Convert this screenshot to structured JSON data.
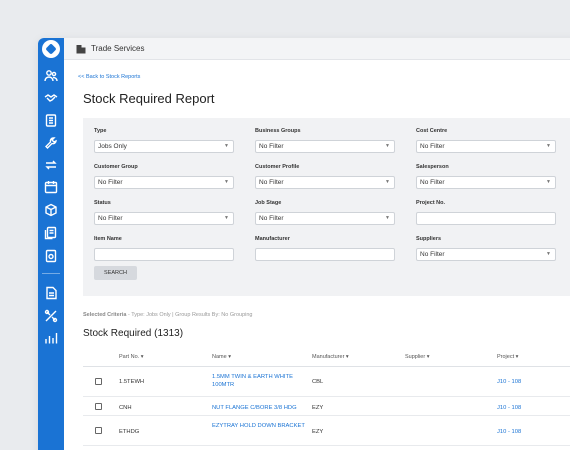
{
  "app": {
    "title": "Trade Services"
  },
  "page": {
    "back_link": "<< Back to Stock Reports",
    "title": "Stock Required Report"
  },
  "filters": [
    {
      "label": "Type",
      "value": "Jobs Only",
      "kind": "select"
    },
    {
      "label": "Business Groups",
      "value": "No Filter",
      "kind": "select"
    },
    {
      "label": "Cost Centre",
      "value": "No Filter",
      "kind": "select"
    },
    {
      "label": "Customer Group",
      "value": "No Filter",
      "kind": "select"
    },
    {
      "label": "Customer Profile",
      "value": "No Filter",
      "kind": "select"
    },
    {
      "label": "Salesperson",
      "value": "No Filter",
      "kind": "select"
    },
    {
      "label": "Status",
      "value": "No Filter",
      "kind": "select"
    },
    {
      "label": "Job Stage",
      "value": "No Filter",
      "kind": "select"
    },
    {
      "label": "Project No.",
      "value": "",
      "kind": "text"
    },
    {
      "label": "Item Name",
      "value": "",
      "kind": "text"
    },
    {
      "label": "Manufacturer",
      "value": "",
      "kind": "text"
    },
    {
      "label": "Suppliers",
      "value": "No Filter",
      "kind": "select"
    }
  ],
  "search_button": "SEARCH",
  "criteria": {
    "label": "Selected Criteria",
    "text": " - Type: Jobs Only | Group Results By: No Grouping"
  },
  "results": {
    "heading": "Stock Required (1313)",
    "columns": [
      "Part No. ▾",
      "Name ▾",
      "Manufacturer ▾",
      "Supplier ▾",
      "Project ▾"
    ],
    "rows": [
      {
        "part_no": "1.5TEWH",
        "name": "1.5MM TWIN & EARTH WHITE 100MTR",
        "manufacturer": "CBL",
        "supplier": "",
        "project": "J10 - 108"
      },
      {
        "part_no": "CNH",
        "name": "NUT FLANGE C/BORE 3/8 HDG",
        "manufacturer": "EZY",
        "supplier": "",
        "project": "J10 - 108"
      },
      {
        "part_no": "ETHDG",
        "name": "EZYTRAY HOLD DOWN BRACKET",
        "manufacturer": "EZY",
        "supplier": "",
        "project": "J10 - 108"
      }
    ]
  },
  "colors": {
    "sidebar": "#1a73d4",
    "link": "#1a73d4",
    "panel": "#f1f2f4"
  }
}
